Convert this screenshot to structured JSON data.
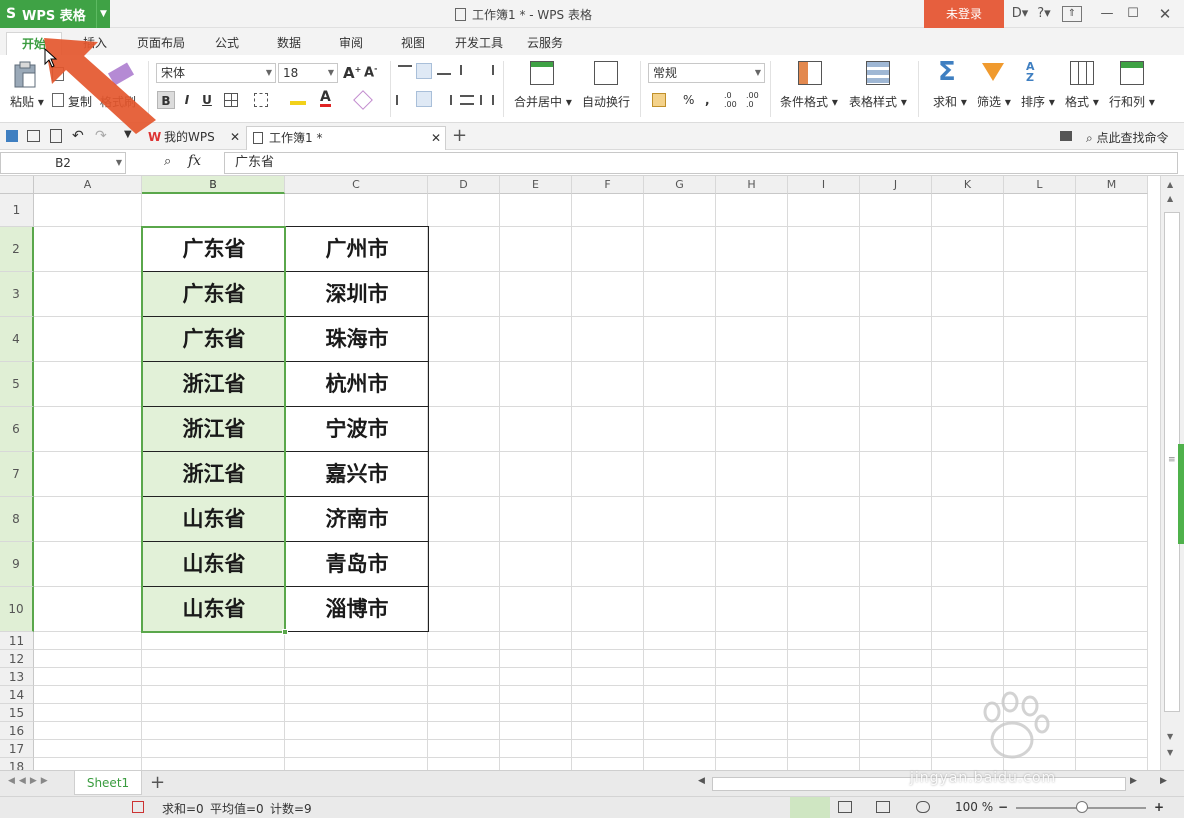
{
  "app": {
    "logo_label": "WPS 表格",
    "window_title": "工作簿1 * - WPS 表格",
    "login_label": "未登录",
    "title_icons": [
      "skin-icon",
      "help-icon",
      "minimize-ribbon-icon",
      "minimize-icon",
      "maximize-icon",
      "close-icon"
    ]
  },
  "menu_tabs": [
    "开始",
    "插入",
    "页面布局",
    "公式",
    "数据",
    "审阅",
    "视图",
    "开发工具",
    "云服务"
  ],
  "ribbon": {
    "paste_label": "粘贴",
    "copy_label": "复制",
    "format_painter_label": "格式刷",
    "font_name": "宋体",
    "font_size": "18",
    "bold": "B",
    "italic": "I",
    "underline": "U",
    "merge_center_label": "合并居中",
    "wrap_text_label": "自动换行",
    "number_format": "常规",
    "percent": "%",
    "thousands": ",",
    "conditional_format_label": "条件格式",
    "table_style_label": "表格样式",
    "sum_label": "求和",
    "filter_label": "筛选",
    "sort_label": "排序",
    "format_label": "格式",
    "rowcol_label": "行和列"
  },
  "quick_access": {
    "tabs": [
      {
        "label": "我的WPS"
      },
      {
        "label": "工作簿1 *"
      }
    ],
    "command_search": "点此查找命令"
  },
  "formula_bar": {
    "name_box": "B2",
    "fx": "fx",
    "value": "广东省"
  },
  "grid": {
    "columns": [
      "A",
      "B",
      "C",
      "D",
      "E",
      "F",
      "G",
      "H",
      "I",
      "J",
      "K",
      "L",
      "M"
    ],
    "rows": [
      "1",
      "2",
      "3",
      "4",
      "5",
      "6",
      "7",
      "8",
      "9",
      "10",
      "11",
      "12",
      "13",
      "14",
      "15",
      "16",
      "17",
      "18"
    ],
    "selected_column": "B",
    "table": [
      [
        "广东省",
        "广州市"
      ],
      [
        "广东省",
        "深圳市"
      ],
      [
        "广东省",
        "珠海市"
      ],
      [
        "浙江省",
        "杭州市"
      ],
      [
        "浙江省",
        "宁波市"
      ],
      [
        "浙江省",
        "嘉兴市"
      ],
      [
        "山东省",
        "济南市"
      ],
      [
        "山东省",
        "青岛市"
      ],
      [
        "山东省",
        "淄博市"
      ]
    ]
  },
  "sheet_tabs": [
    "Sheet1"
  ],
  "status": {
    "sum": "求和=0",
    "average": "平均值=0",
    "count": "计数=9",
    "zoom": "100 %"
  },
  "watermark": {
    "text": "jingyan.baidu.com"
  },
  "colors": {
    "accent_green": "#3fa245",
    "login_orange": "#e65f3e",
    "selection_fill": "#e2f1d8",
    "arrow_red": "#e4572e"
  }
}
